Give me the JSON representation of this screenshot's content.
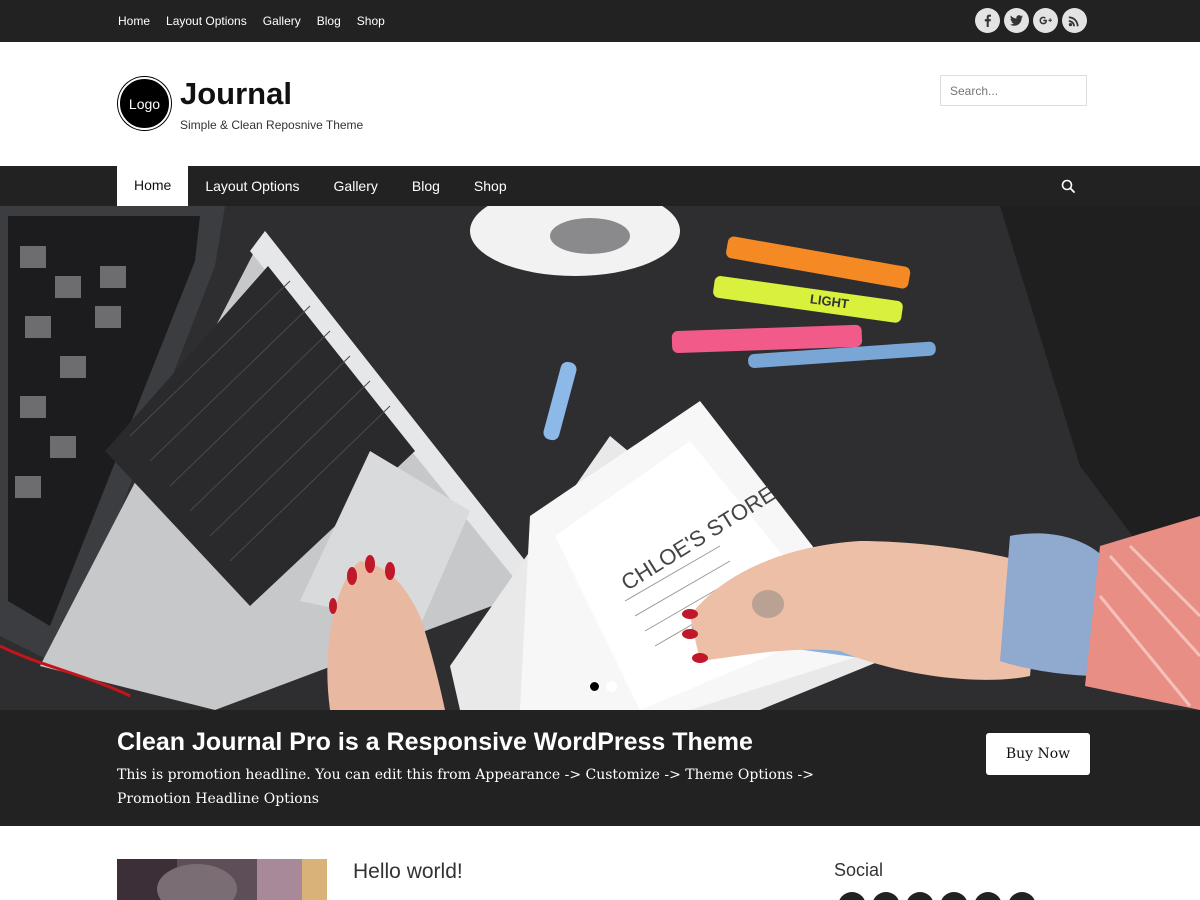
{
  "top_nav": [
    "Home",
    "Layout Options",
    "Gallery",
    "Blog",
    "Shop"
  ],
  "social_top": [
    "facebook-icon",
    "twitter-icon",
    "google-plus-icon",
    "rss-icon"
  ],
  "header": {
    "logo_text": "Logo",
    "site_title": "Journal",
    "tagline": "Simple & Clean Reposnive Theme",
    "search_placeholder": "Search..."
  },
  "main_nav": {
    "items": [
      "Home",
      "Layout Options",
      "Gallery",
      "Blog",
      "Shop"
    ],
    "active": "Home"
  },
  "hero": {
    "slide_count": 2,
    "active_slide": 1,
    "marker_labels": [
      "LIGHT",
      "CHLOE'S STORE"
    ]
  },
  "promo": {
    "title": "Clean Journal Pro is a Responsive WordPress Theme",
    "text": "This is promotion headline. You can edit this from Appearance -> Customize -> Theme Options -> Promotion Headline Options",
    "button": "Buy Now"
  },
  "content": {
    "post_title": "Hello world!"
  },
  "sidebar": {
    "widget_title": "Social"
  },
  "colors": {
    "bar": "#222222",
    "accent": "#ffffff"
  }
}
